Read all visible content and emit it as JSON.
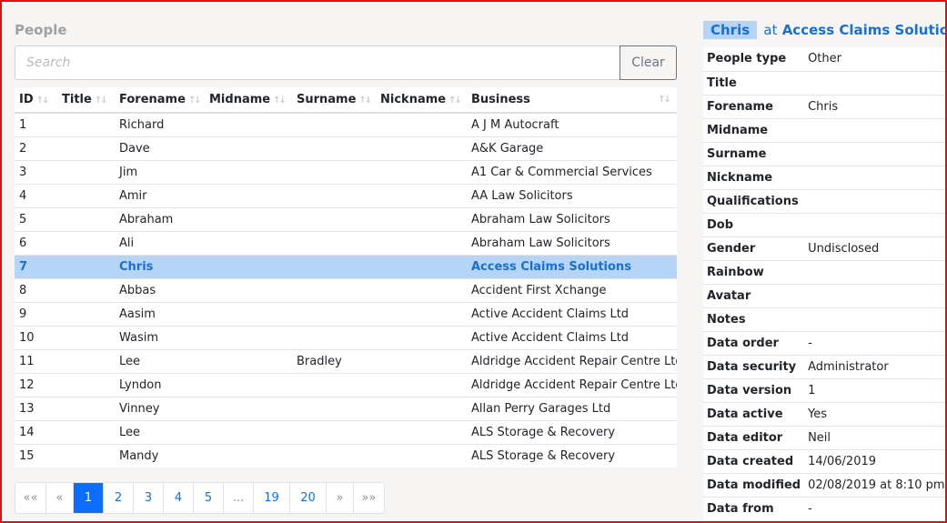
{
  "people": {
    "title": "People",
    "search_placeholder": "Search",
    "search_value": "",
    "clear_label": "Clear",
    "columns": [
      "ID",
      "Title",
      "Forename",
      "Midname",
      "Surname",
      "Nickname",
      "Business"
    ],
    "rows": [
      [
        "1",
        "",
        "Richard",
        "",
        "",
        "",
        "A J M Autocraft"
      ],
      [
        "2",
        "",
        "Dave",
        "",
        "",
        "",
        "A&K Garage"
      ],
      [
        "3",
        "",
        "Jim",
        "",
        "",
        "",
        "A1 Car & Commercial Services"
      ],
      [
        "4",
        "",
        "Amir",
        "",
        "",
        "",
        "AA Law Solicitors"
      ],
      [
        "5",
        "",
        "Abraham",
        "",
        "",
        "",
        "Abraham Law Solicitors"
      ],
      [
        "6",
        "",
        "Ali",
        "",
        "",
        "",
        "Abraham Law Solicitors"
      ],
      [
        "7",
        "",
        "Chris",
        "",
        "",
        "",
        "Access Claims Solutions"
      ],
      [
        "8",
        "",
        "Abbas",
        "",
        "",
        "",
        "Accident First Xchange"
      ],
      [
        "9",
        "",
        "Aasim",
        "",
        "",
        "",
        "Active Accident Claims Ltd"
      ],
      [
        "10",
        "",
        "Wasim",
        "",
        "",
        "",
        "Active Accident Claims Ltd"
      ],
      [
        "11",
        "",
        "Lee",
        "",
        "Bradley",
        "",
        "Aldridge Accident Repair Centre Ltd"
      ],
      [
        "12",
        "",
        "Lyndon",
        "",
        "",
        "",
        "Aldridge Accident Repair Centre Ltd"
      ],
      [
        "13",
        "",
        "Vinney",
        "",
        "",
        "",
        "Allan Perry Garages Ltd"
      ],
      [
        "14",
        "",
        "Lee",
        "",
        "",
        "",
        "ALS Storage & Recovery"
      ],
      [
        "15",
        "",
        "Mandy",
        "",
        "",
        "",
        "ALS Storage & Recovery"
      ]
    ],
    "selected_row": 6
  },
  "pagination": {
    "items": [
      {
        "label": "««",
        "type": "first"
      },
      {
        "label": "«",
        "type": "prev"
      },
      {
        "label": "1",
        "type": "page",
        "active": true
      },
      {
        "label": "2",
        "type": "page"
      },
      {
        "label": "3",
        "type": "page"
      },
      {
        "label": "4",
        "type": "page"
      },
      {
        "label": "5",
        "type": "page"
      },
      {
        "label": "...",
        "type": "ellipsis"
      },
      {
        "label": "19",
        "type": "page"
      },
      {
        "label": "20",
        "type": "page"
      },
      {
        "label": "»",
        "type": "next"
      },
      {
        "label": "»»",
        "type": "last"
      }
    ]
  },
  "detail": {
    "name": "Chris",
    "at": "at",
    "business": "Access Claims Solutions",
    "fields": [
      {
        "key": "People type",
        "value": "Other"
      },
      {
        "key": "Title",
        "value": ""
      },
      {
        "key": "Forename",
        "value": "Chris"
      },
      {
        "key": "Midname",
        "value": ""
      },
      {
        "key": "Surname",
        "value": ""
      },
      {
        "key": "Nickname",
        "value": ""
      },
      {
        "key": "Qualifications",
        "value": ""
      },
      {
        "key": "Dob",
        "value": ""
      },
      {
        "key": "Gender",
        "value": "Undisclosed"
      },
      {
        "key": "Rainbow",
        "value": ""
      },
      {
        "key": "Avatar",
        "value": ""
      },
      {
        "key": "Notes",
        "value": ""
      },
      {
        "key": "Data order",
        "value": "-"
      },
      {
        "key": "Data security",
        "value": "Administrator"
      },
      {
        "key": "Data version",
        "value": "1"
      },
      {
        "key": "Data active",
        "value": "Yes"
      },
      {
        "key": "Data editor",
        "value": "Neil"
      },
      {
        "key": "Data created",
        "value": "14/06/2019"
      },
      {
        "key": "Data modified",
        "value": "02/08/2019 at 8:10 pm"
      },
      {
        "key": "Data from",
        "value": "-"
      }
    ]
  },
  "colors": {
    "accent": "#0d6efd",
    "selected_bg": "#b6d4f5",
    "selected_text": "#1a6fd3",
    "frame_border": "#e01010"
  },
  "icons": {
    "sort": "sort-arrows-icon"
  }
}
